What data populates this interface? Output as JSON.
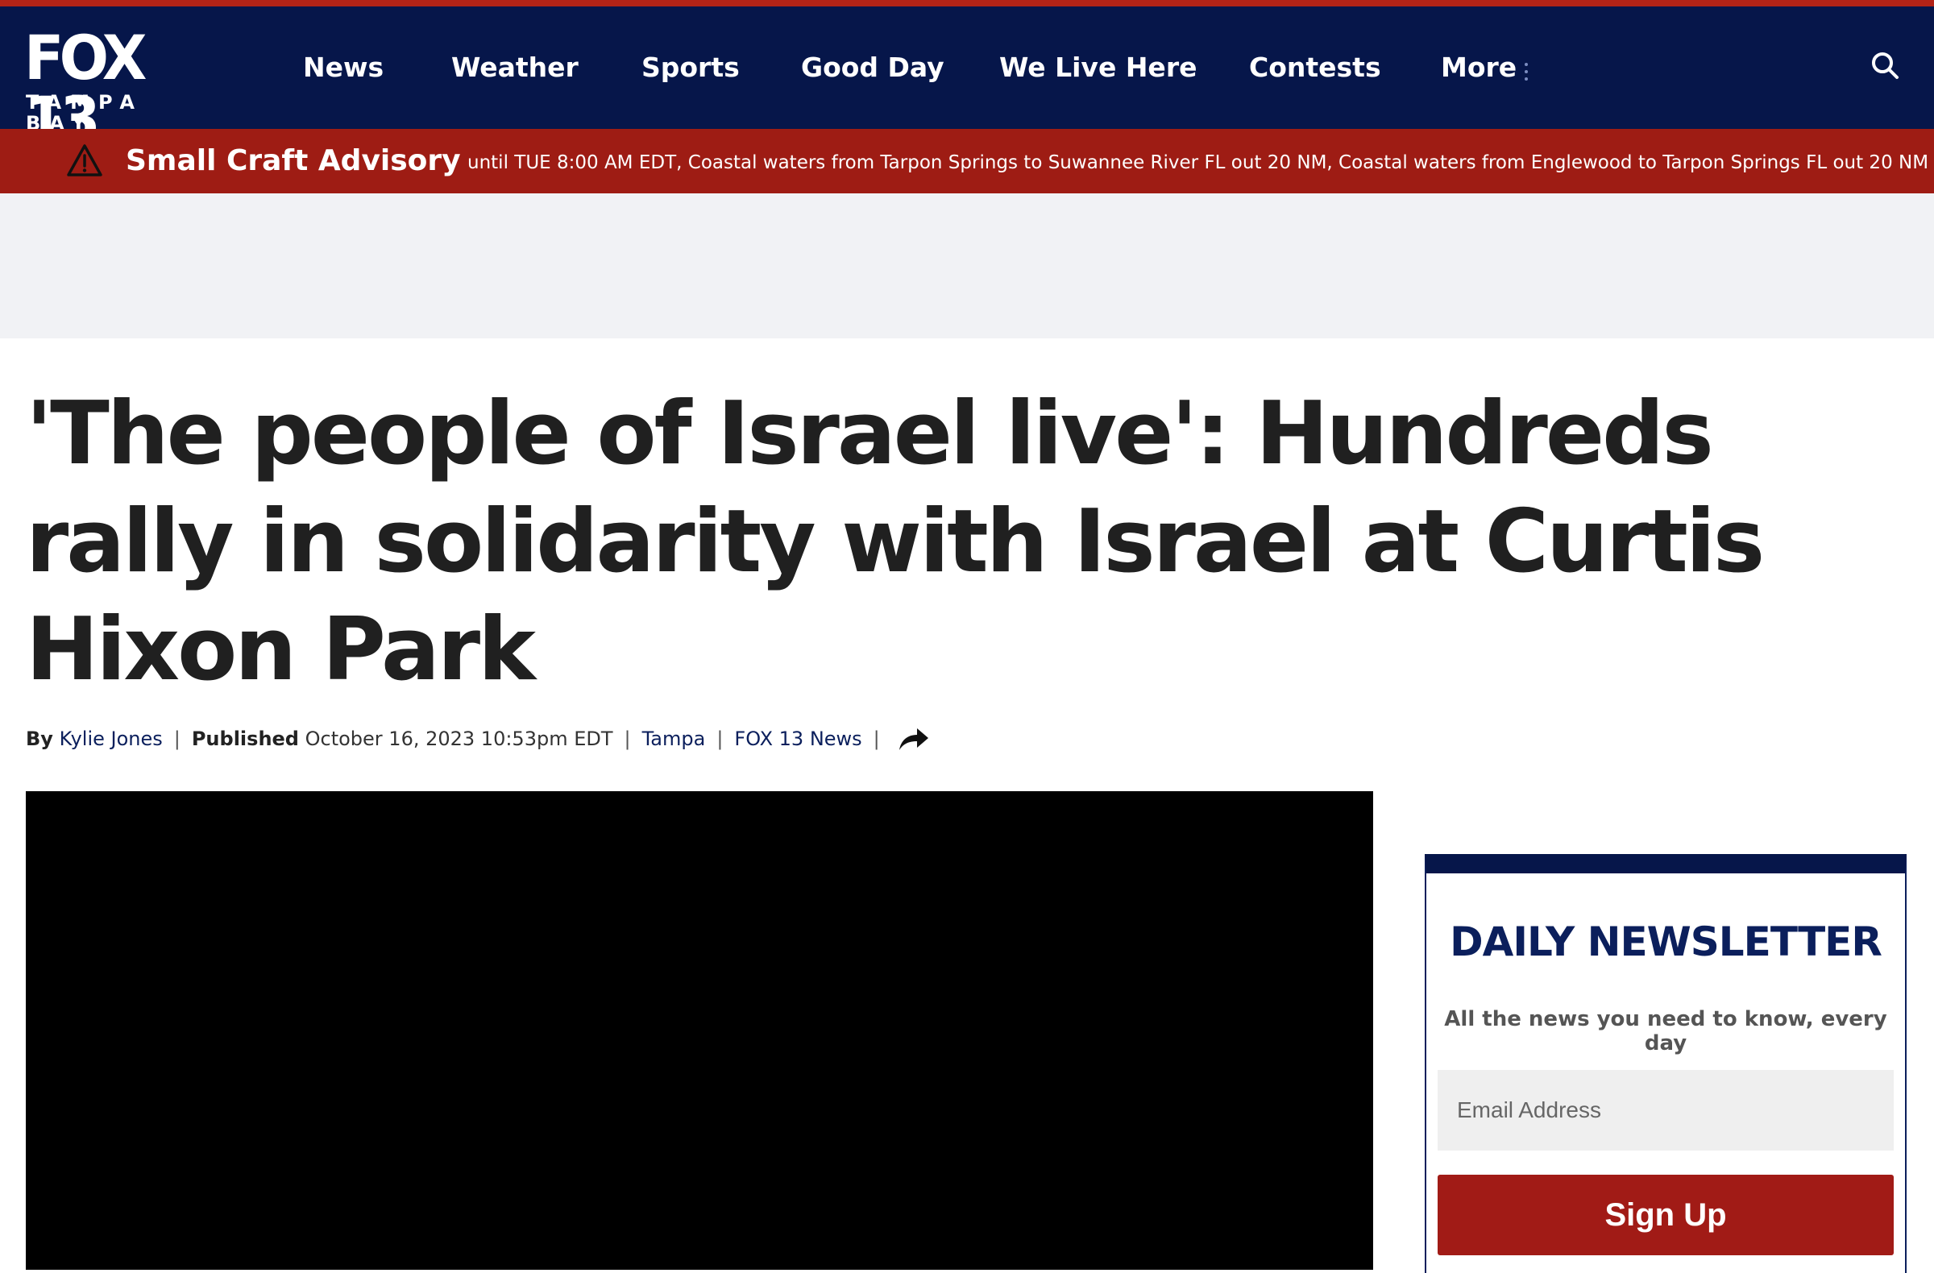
{
  "header": {
    "logo": {
      "main": "FOX 13",
      "sub": "TAMPA BAY"
    },
    "nav": [
      "News",
      "Weather",
      "Sports",
      "Good Day",
      "We Live Here",
      "Contests",
      "More"
    ],
    "search_icon": "search-icon",
    "colors": {
      "background": "#06164a",
      "accent": "#b32317"
    }
  },
  "alert": {
    "icon": "warning-triangle-icon",
    "title": "Small Craft Advisory",
    "text": "until TUE 8:00 AM EDT, Coastal waters from Tarpon Springs to Suwannee River FL out 20 NM, Coastal waters from Englewood to Tarpon Springs FL out 20 NM",
    "color": "#9e1c14"
  },
  "article": {
    "headline": "'The people of Israel live': Hundreds rally in solidarity with Israel at Curtis Hixon Park",
    "byline": {
      "by_label": "By",
      "author": "Kylie Jones",
      "published_label": "Published",
      "published_date": "October 16, 2023 10:53pm EDT",
      "location": "Tampa",
      "source": "FOX 13 News",
      "share_icon": "share-arrow-icon"
    }
  },
  "newsletter": {
    "title": "DAILY NEWSLETTER",
    "subtitle": "All the news you need to know, every day",
    "email_placeholder": "Email Address",
    "button": "Sign Up",
    "colors": {
      "title": "#0b1f5c",
      "button": "#a11b16"
    }
  }
}
